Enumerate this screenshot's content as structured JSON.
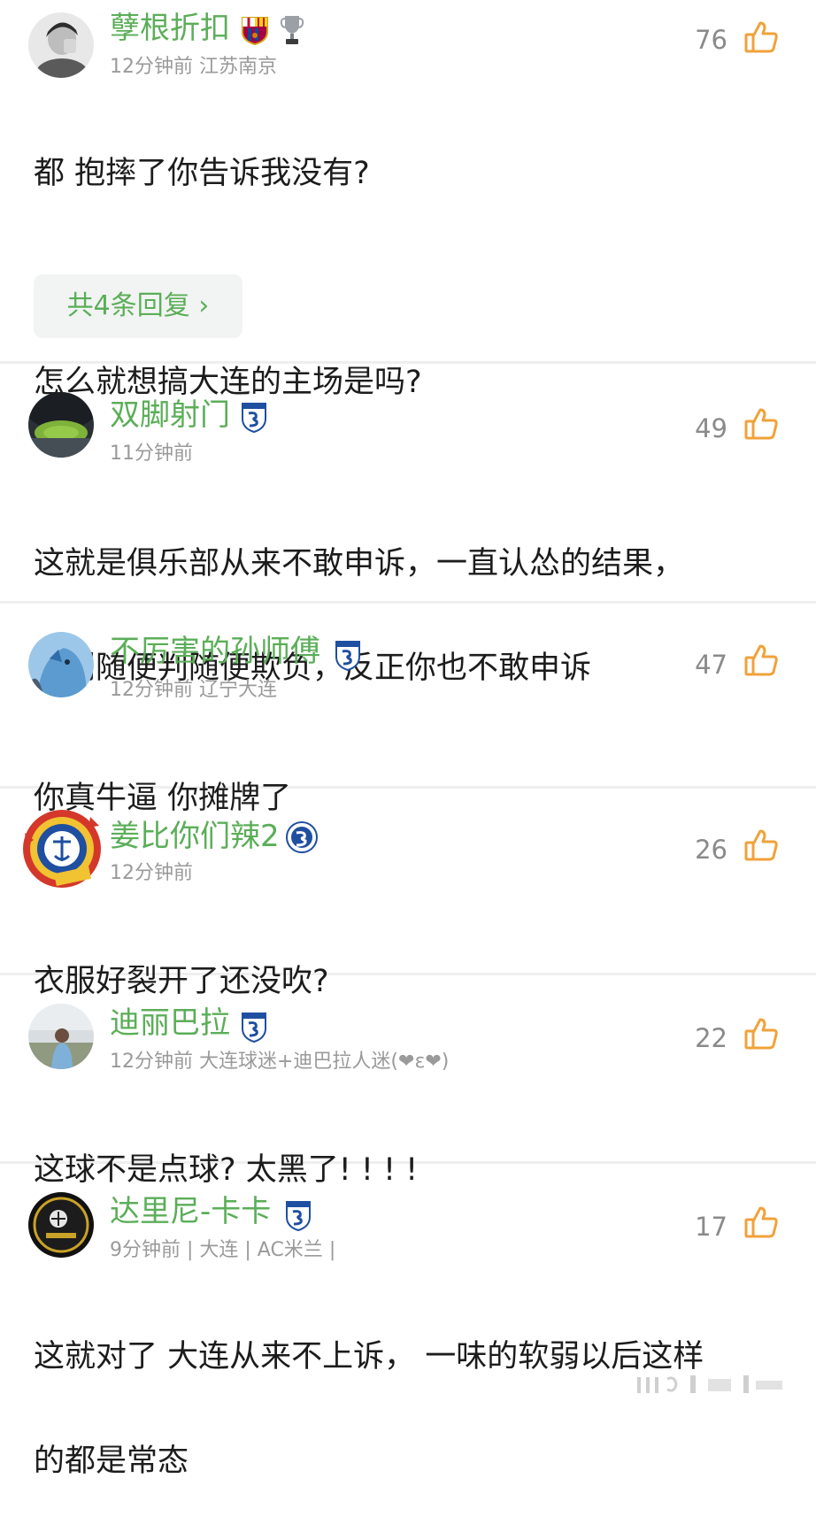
{
  "comments": [
    {
      "username": "孽根折扣",
      "time": "12分钟前",
      "location": "江苏南京",
      "likes": "76",
      "lines": [
        "都 抱摔了你告诉我没有?",
        "",
        "怎么就想搞大连的主场是吗?"
      ],
      "replies_label": "共4条回复",
      "badges": [
        "fc-barcelona-crest-icon",
        "trophy-icon"
      ]
    },
    {
      "username": "双脚射门",
      "time": "11分钟前",
      "location": "",
      "likes": "49",
      "lines": [
        "这就是俱乐部从来不敢申诉，一直认怂的结果，",
        "裁判随便判随便欺负，反正你也不敢申诉"
      ],
      "badges": [
        "dalian-club-crest-icon"
      ]
    },
    {
      "username": "不厉害的孙师傅",
      "time": "12分钟前",
      "location": "辽宁大连",
      "likes": "47",
      "lines": [
        "你真牛逼 你摊牌了"
      ],
      "badges": [
        "dalian-club-crest-icon"
      ]
    },
    {
      "username": "姜比你们辣2",
      "time": "12分钟前",
      "location": "",
      "likes": "26",
      "lines": [
        "衣服好裂开了还没吹?"
      ],
      "badges": [
        "dalian-round-badge-icon"
      ]
    },
    {
      "username": "迪丽巴拉",
      "time": "12分钟前",
      "location": "大连球迷+迪巴拉人迷(❤ε❤)",
      "likes": "22",
      "lines": [
        "这球不是点球? 太黑了! ! ! !"
      ],
      "badges": [
        "dalian-club-crest-icon"
      ]
    },
    {
      "username": "达里尼-卡卡",
      "time": "9分钟前",
      "location": "| 大连 | AC米兰 |",
      "likes": "17",
      "lines": [
        "这就对了 大连从来不上诉， 一味的软弱以后这样",
        "的都是常态"
      ],
      "badges": [
        "dalian-club-crest-icon"
      ]
    }
  ],
  "colors": {
    "username": "#5bae58",
    "meta": "#9a9a9a",
    "like_icon": "#f0a23a",
    "text": "#1c1c1c"
  }
}
